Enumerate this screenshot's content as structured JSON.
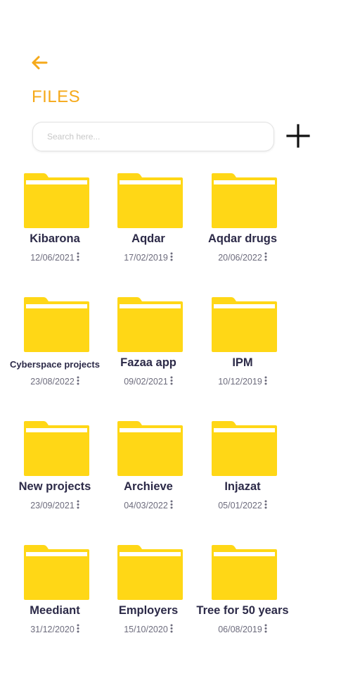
{
  "header": {
    "back_icon": "arrow-left-icon",
    "title": "FILES",
    "accent_color": "#f5a91a"
  },
  "search": {
    "placeholder": "Search here...",
    "value": ""
  },
  "add_button": {
    "icon": "plus-icon"
  },
  "folder_color": "#ffd716",
  "folders": [
    {
      "name": "Kibarona",
      "date": "12/06/2021"
    },
    {
      "name": "Aqdar",
      "date": "17/02/2019"
    },
    {
      "name": "Aqdar drugs",
      "date": "20/06/2022"
    },
    {
      "name": "Cyberspace projects",
      "date": "23/08/2022"
    },
    {
      "name": "Fazaa app",
      "date": "09/02/2021"
    },
    {
      "name": "IPM",
      "date": "10/12/2019"
    },
    {
      "name": "New projects",
      "date": "23/09/2021"
    },
    {
      "name": "Archieve",
      "date": "04/03/2022"
    },
    {
      "name": "Injazat",
      "date": "05/01/2022"
    },
    {
      "name": "Meediant",
      "date": "31/12/2020"
    },
    {
      "name": "Employers",
      "date": "15/10/2020"
    },
    {
      "name": "Tree for 50 years",
      "date": "06/08/2019"
    }
  ]
}
